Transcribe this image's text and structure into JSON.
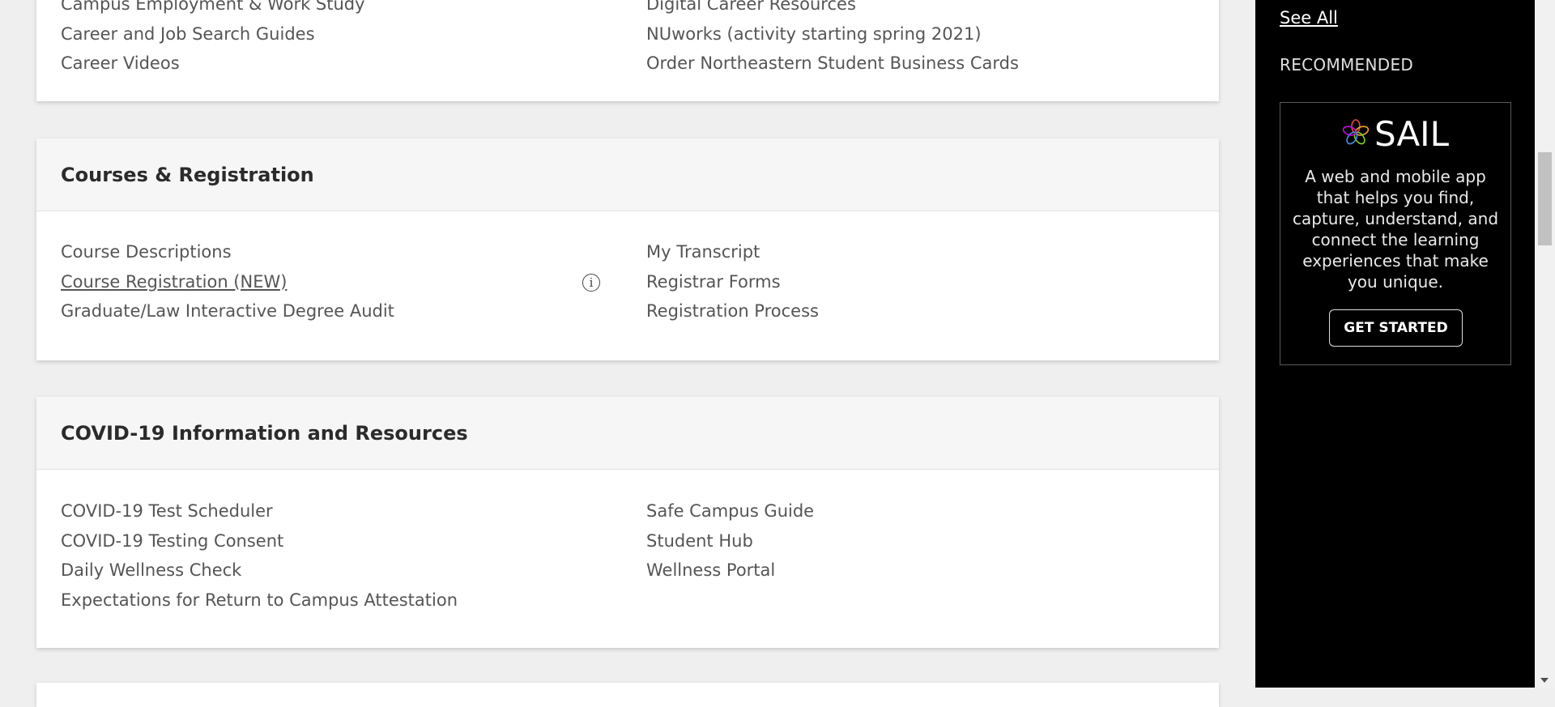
{
  "careers_section": {
    "left_links": [
      "Campus Employment & Work Study",
      "Career and Job Search Guides",
      "Career Videos"
    ],
    "right_links": [
      "Digital Career Resources",
      "NUworks (activity starting spring 2021)",
      "Order Northeastern Student Business Cards"
    ]
  },
  "courses_section": {
    "title": "Courses & Registration",
    "left_links": [
      "Course Descriptions",
      "Course Registration (NEW)",
      "Graduate/Law Interactive Degree Audit"
    ],
    "right_links": [
      "My Transcript",
      "Registrar Forms",
      "Registration Process"
    ],
    "info_icon_glyph": "i"
  },
  "covid_section": {
    "title": "COVID-19 Information and Resources",
    "left_links": [
      "COVID-19 Test Scheduler",
      "COVID-19 Testing Consent",
      "Daily Wellness Check",
      "Expectations for Return to Campus Attestation"
    ],
    "right_links": [
      "Safe Campus Guide",
      "Student Hub",
      "Wellness Portal"
    ]
  },
  "sidebar": {
    "see_all": "See All",
    "recommended_label": "RECOMMENDED",
    "promo": {
      "logo_text": "SAIL",
      "logo_icon": "sail-flower-icon",
      "description": "A web and mobile app that helps you find, capture, understand, and connect the learning experiences that make you unique.",
      "cta_label": "GET STARTED"
    }
  },
  "colors": {
    "page_background": "#efefef",
    "card_background": "#ffffff",
    "card_header_background": "#f6f6f6",
    "sidebar_background": "#000000",
    "link_text": "#555555",
    "title_text": "#2b2b2b"
  }
}
